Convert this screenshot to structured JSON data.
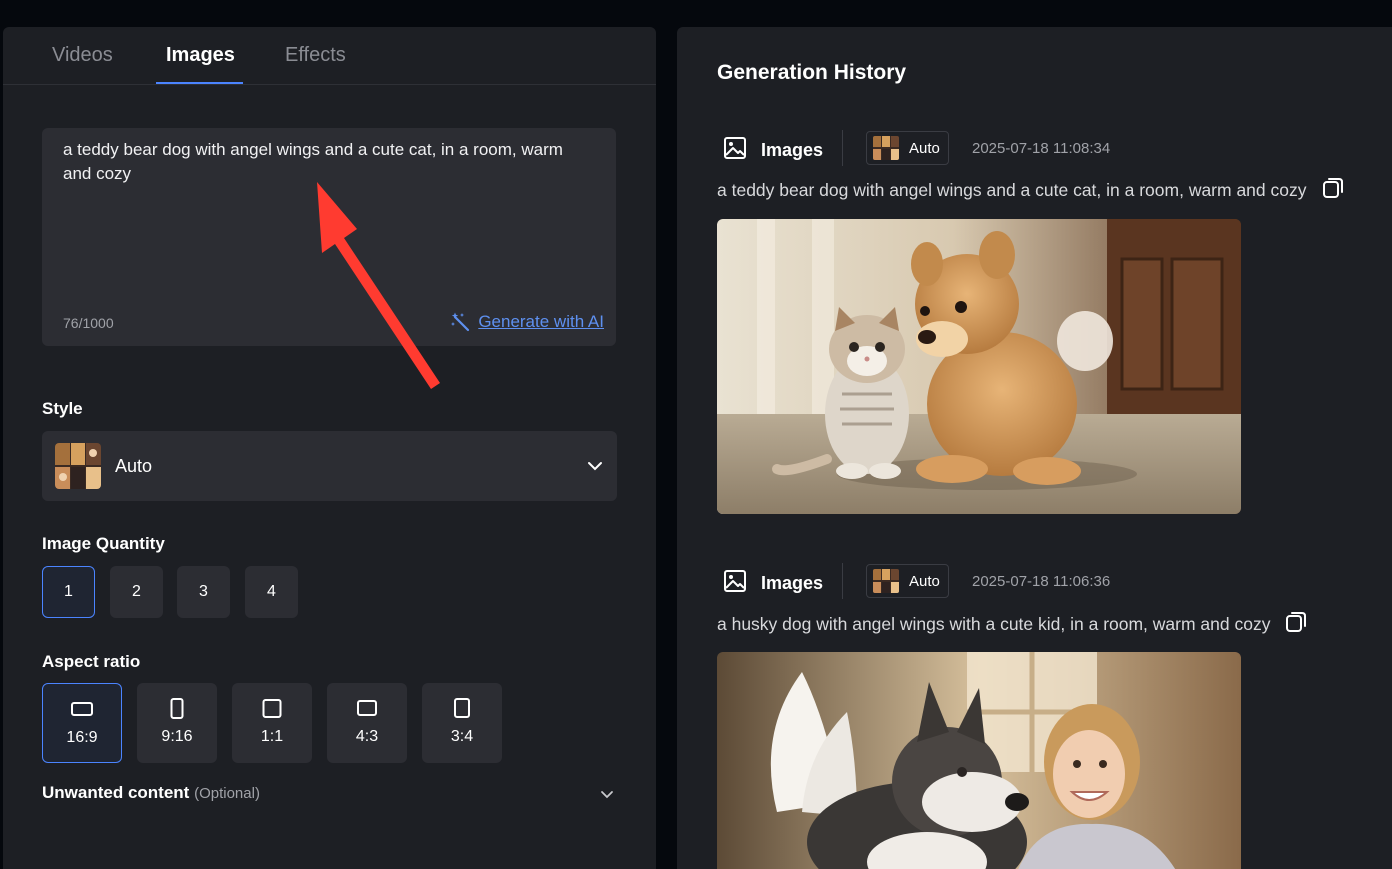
{
  "tabs": [
    "Videos",
    "Images",
    "Effects"
  ],
  "prompt": {
    "value": "a teddy bear dog with angel wings and a cute cat, in a room, warm and cozy",
    "char_count": "76/1000",
    "generate_ai_label": "Generate with AI"
  },
  "style": {
    "label": "Style",
    "selected": "Auto"
  },
  "quantity": {
    "label": "Image Quantity",
    "options": [
      "1",
      "2",
      "3",
      "4"
    ],
    "selected": "1"
  },
  "aspect_ratio": {
    "label": "Aspect ratio",
    "options": [
      "16:9",
      "9:16",
      "1:1",
      "4:3",
      "3:4"
    ],
    "selected": "16:9"
  },
  "unwanted": {
    "label": "Unwanted content",
    "optional": "(Optional)"
  },
  "history": {
    "title": "Generation History",
    "entries": [
      {
        "type": "Images",
        "style": "Auto",
        "timestamp": "2025-07-18 11:08:34",
        "prompt": "a teddy bear dog with angel wings and a cute cat, in a room, warm and cozy"
      },
      {
        "type": "Images",
        "style": "Auto",
        "timestamp": "2025-07-18 11:06:36",
        "prompt": "a husky dog with angel wings with a cute kid, in a room, warm and cozy"
      }
    ]
  },
  "colors": {
    "accent": "#4b84ff",
    "link": "#5e90f0",
    "panel": "#1d1f24",
    "control": "#2c2d33",
    "annotation": "#ff3b30"
  },
  "icons": [
    "magic-wand-icon",
    "chevron-down-icon",
    "image-icon",
    "copy-icon"
  ]
}
